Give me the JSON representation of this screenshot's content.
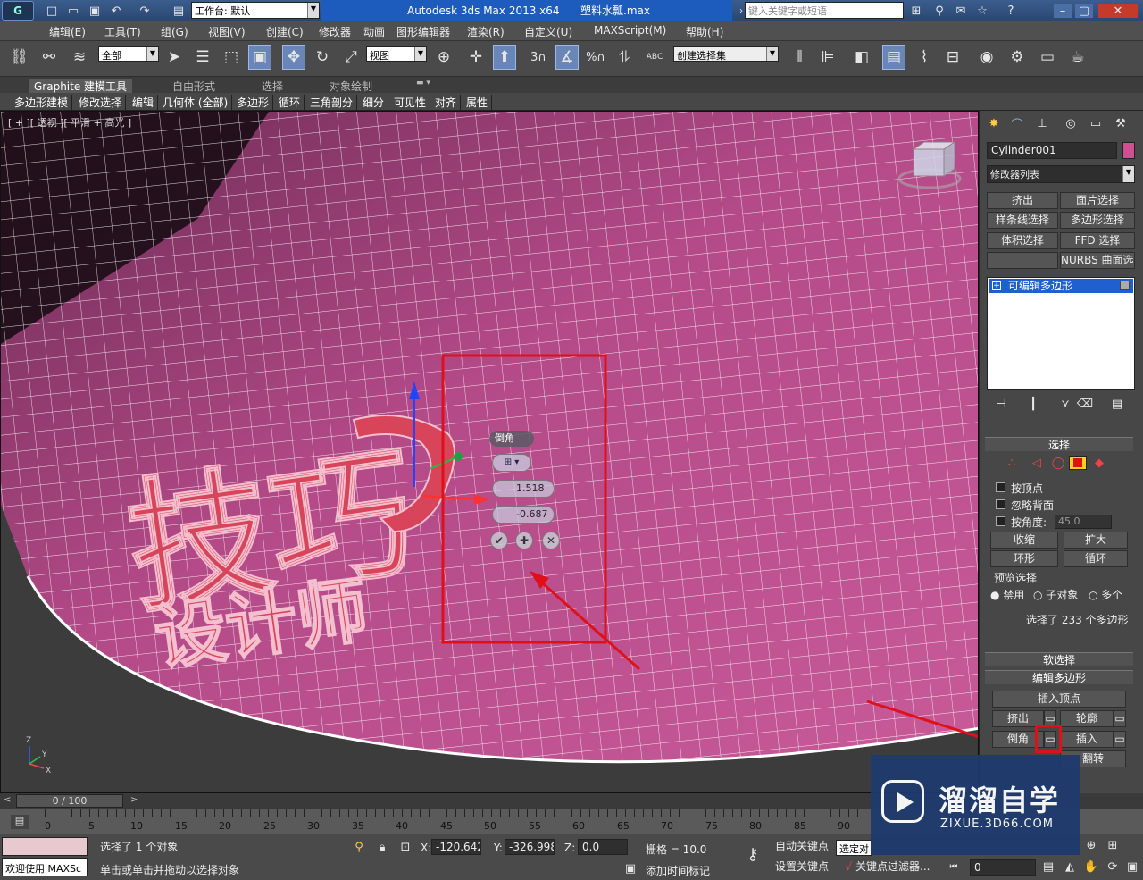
{
  "titlebar": {
    "workspace_label": "工作台: 默认",
    "app_title": "Autodesk 3ds Max  2013 x64",
    "file_name": "塑料水瓢.max",
    "search_placeholder": "键入关键字或短语"
  },
  "menu": [
    "编辑(E)",
    "工具(T)",
    "组(G)",
    "视图(V)",
    "创建(C)",
    "修改器",
    "动画",
    "图形编辑器",
    "渲染(R)",
    "自定义(U)",
    "MAXScript(M)",
    "帮助(H)"
  ],
  "toolbar": {
    "filter_value": "全部",
    "view_value": "视图",
    "selection_set_placeholder": "创建选择集",
    "snap_3": "3",
    "snap_percent": "%",
    "abc": "ABC"
  },
  "ribbon": {
    "tabs": [
      "Graphite 建模工具",
      "自由形式",
      "选择",
      "对象绘制"
    ],
    "subtabs": [
      "多边形建模",
      "修改选择",
      "编辑",
      "几何体 (全部)",
      "多边形",
      "循环",
      "三角剖分",
      "细分",
      "可见性",
      "对齐",
      "属性"
    ]
  },
  "viewport": {
    "label": "[ + ][ 透视 ][ 平滑 + 高光 ]",
    "caddy": {
      "title": "倒角",
      "height_value": "1.518",
      "outline_value": "-0.687"
    },
    "axis_z": "Z",
    "axis_x": "X",
    "axis_y": "Y",
    "text_line1": "技巧",
    "text_line2": "设计师"
  },
  "command_panel": {
    "object_name": "Cylinder001",
    "modifier_list": "修改器列表",
    "buttons": [
      "挤出",
      "面片选择",
      "样条线选择",
      "多边形选择",
      "体积选择",
      "FFD 选择",
      "",
      "NURBS 曲面选择"
    ],
    "stack_item": "可编辑多边形",
    "selection": {
      "header": "选择",
      "by_vertex": "按顶点",
      "ignore_backface": "忽略背面",
      "by_angle": "按角度:",
      "angle_value": "45.0",
      "shrink": "收缩",
      "grow": "扩大",
      "ring": "环形",
      "loop": "循环",
      "preview_label": "预览选择",
      "preview_off": "禁用",
      "preview_sub": "子对象",
      "preview_multi": "多个",
      "status": "选择了 233 个多边形"
    },
    "soft_selection": "软选择",
    "edit_polygons": {
      "header": "编辑多边形",
      "insert_vertex": "插入顶点",
      "extrude": "挤出",
      "outline": "轮廓",
      "bevel": "倒角",
      "inset": "插入",
      "flip": "翻转"
    }
  },
  "timeline": {
    "frame_label": "0 / 100",
    "ticks": [
      "0",
      "5",
      "10",
      "15",
      "20",
      "25",
      "30",
      "35",
      "40",
      "45",
      "50",
      "55",
      "60",
      "65",
      "70",
      "75",
      "80",
      "85",
      "90"
    ]
  },
  "status": {
    "welcome": "欢迎使用 MAXSc",
    "selected_text": "选择了 1 个对象",
    "prompt_text": "单击或单击并拖动以选择对象",
    "x_label": "X:",
    "x_value": "-120.642",
    "y_label": "Y:",
    "y_value": "-326.998",
    "z_label": "Z:",
    "z_value": "0.0",
    "grid": "栅格 = 10.0",
    "add_time_tag": "添加时间标记",
    "auto_key": "自动关键点",
    "set_key": "设置关键点",
    "selected_object": "选定对",
    "key_filters": "关键点过滤器...",
    "frame_value": "0"
  },
  "watermark": {
    "title": "溜溜自学",
    "url": "ZIXUE.3D66.COM"
  },
  "colors": {
    "mesh_pink": "#c0538f",
    "highlight_red": "#e0101a",
    "text_red": "#d8445a",
    "watermark_bg": "#1e3a6e"
  }
}
